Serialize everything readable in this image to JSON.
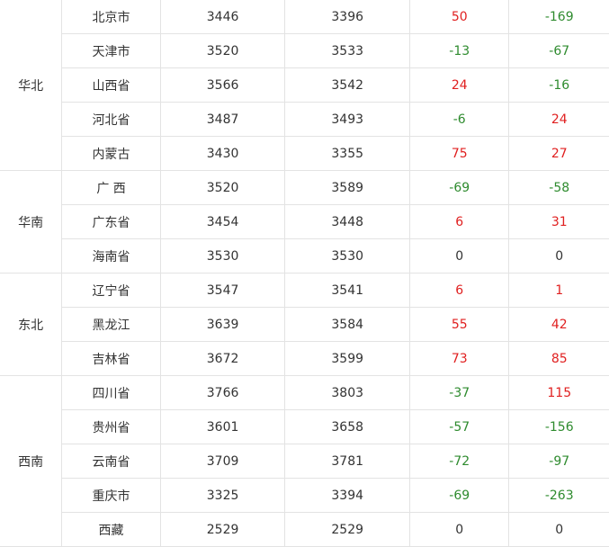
{
  "colors": {
    "up": "#e02020",
    "down": "#2e8b2e",
    "flat": "#333333"
  },
  "regions": [
    {
      "name": "华北",
      "rows": [
        {
          "province": "北京市",
          "a": "3446",
          "b": "3396",
          "c": "50",
          "d": "-169",
          "c_trend": "up",
          "d_trend": "down"
        },
        {
          "province": "天津市",
          "a": "3520",
          "b": "3533",
          "c": "-13",
          "d": "-67",
          "c_trend": "down",
          "d_trend": "down"
        },
        {
          "province": "山西省",
          "a": "3566",
          "b": "3542",
          "c": "24",
          "d": "-16",
          "c_trend": "up",
          "d_trend": "down"
        },
        {
          "province": "河北省",
          "a": "3487",
          "b": "3493",
          "c": "-6",
          "d": "24",
          "c_trend": "down",
          "d_trend": "up"
        },
        {
          "province": "内蒙古",
          "a": "3430",
          "b": "3355",
          "c": "75",
          "d": "27",
          "c_trend": "up",
          "d_trend": "up"
        }
      ]
    },
    {
      "name": "华南",
      "rows": [
        {
          "province": "广 西",
          "a": "3520",
          "b": "3589",
          "c": "-69",
          "d": "-58",
          "c_trend": "down",
          "d_trend": "down"
        },
        {
          "province": "广东省",
          "a": "3454",
          "b": "3448",
          "c": "6",
          "d": "31",
          "c_trend": "up",
          "d_trend": "up"
        },
        {
          "province": "海南省",
          "a": "3530",
          "b": "3530",
          "c": "0",
          "d": "0",
          "c_trend": "flat",
          "d_trend": "flat"
        }
      ]
    },
    {
      "name": "东北",
      "rows": [
        {
          "province": "辽宁省",
          "a": "3547",
          "b": "3541",
          "c": "6",
          "d": "1",
          "c_trend": "up",
          "d_trend": "up"
        },
        {
          "province": "黑龙江",
          "a": "3639",
          "b": "3584",
          "c": "55",
          "d": "42",
          "c_trend": "up",
          "d_trend": "up"
        },
        {
          "province": "吉林省",
          "a": "3672",
          "b": "3599",
          "c": "73",
          "d": "85",
          "c_trend": "up",
          "d_trend": "up"
        }
      ]
    },
    {
      "name": "西南",
      "rows": [
        {
          "province": "四川省",
          "a": "3766",
          "b": "3803",
          "c": "-37",
          "d": "115",
          "c_trend": "down",
          "d_trend": "up"
        },
        {
          "province": "贵州省",
          "a": "3601",
          "b": "3658",
          "c": "-57",
          "d": "-156",
          "c_trend": "down",
          "d_trend": "down"
        },
        {
          "province": "云南省",
          "a": "3709",
          "b": "3781",
          "c": "-72",
          "d": "-97",
          "c_trend": "down",
          "d_trend": "down"
        },
        {
          "province": "重庆市",
          "a": "3325",
          "b": "3394",
          "c": "-69",
          "d": "-263",
          "c_trend": "down",
          "d_trend": "down"
        },
        {
          "province": "西藏",
          "a": "2529",
          "b": "2529",
          "c": "0",
          "d": "0",
          "c_trend": "flat",
          "d_trend": "flat"
        }
      ]
    }
  ]
}
